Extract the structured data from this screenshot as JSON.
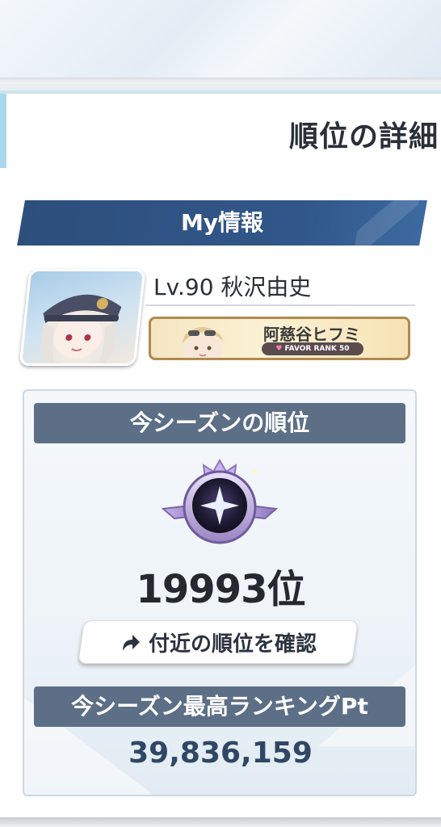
{
  "panel": {
    "title": "順位の詳細"
  },
  "my_info": {
    "header": "My情報",
    "player_name": "Lv.90 秋沢由史",
    "favor_character": "阿慈谷ヒフミ",
    "favor_rank": "FAVOR RANK 50"
  },
  "season": {
    "rank_header": "今シーズンの順位",
    "rank_value": "19993位",
    "check_nearby_button": "付近の順位を確認",
    "best_header": "今シーズン最高ランキングPt",
    "best_value": "39,836,159"
  },
  "colors": {
    "banner": "#2d4f7c",
    "section_header": "#5c6f86",
    "best_value_text": "#2f4765",
    "favor_border": "#b08a4f"
  },
  "icons": [
    "avatar-icon",
    "favor-character-icon",
    "rank-emblem-icon",
    "share-arrow-icon",
    "heart-icon"
  ]
}
